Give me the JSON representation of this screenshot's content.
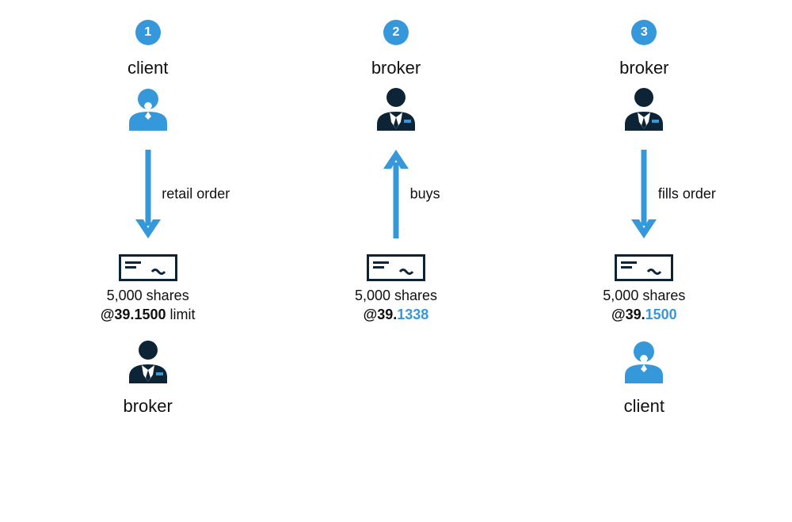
{
  "colors": {
    "accent": "#3498db",
    "dark": "#0d2436"
  },
  "columns": [
    {
      "step": "1",
      "top_role": "client",
      "top_person": "client",
      "arrow_dir": "down",
      "arrow_label": "retail order",
      "ticket": {
        "qty": "5,000 shares",
        "at": "@",
        "whole": "39.",
        "frac": "1500",
        "frac_style": "dark",
        "suffix": " limit"
      },
      "bottom_role": "broker",
      "bottom_person": "broker"
    },
    {
      "step": "2",
      "top_role": "broker",
      "top_person": "broker",
      "arrow_dir": "up",
      "arrow_label": "buys",
      "ticket": {
        "qty": "5,000 shares",
        "at": "@",
        "whole": "39.",
        "frac": "1338",
        "frac_style": "blue",
        "suffix": ""
      },
      "bottom_role": "",
      "bottom_person": ""
    },
    {
      "step": "3",
      "top_role": "broker",
      "top_person": "broker",
      "arrow_dir": "down",
      "arrow_label": "fills order",
      "ticket": {
        "qty": "5,000 shares",
        "at": "@",
        "whole": "39.",
        "frac": "1500",
        "frac_style": "blue",
        "suffix": ""
      },
      "bottom_role": "client",
      "bottom_person": "client"
    }
  ]
}
